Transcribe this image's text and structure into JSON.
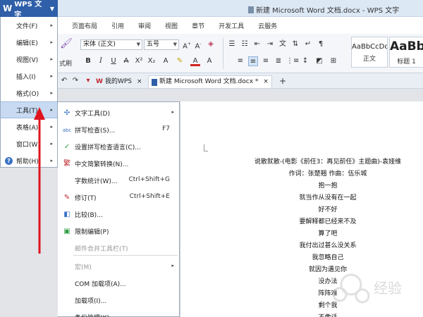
{
  "app": {
    "name": "WPS 文字",
    "window_title": "新建 Microsoft Word 文档.docx - WPS 文字"
  },
  "ribbon_tabs": [
    "页面布局",
    "引用",
    "审阅",
    "视图",
    "章节",
    "开发工具",
    "云服务"
  ],
  "ribbon": {
    "paste_label": "式刷",
    "font_name": "宋体 (正文)",
    "font_size": "五号",
    "styles": [
      {
        "preview": "AaBbCcDd",
        "label": "正文"
      },
      {
        "preview": "AaBb",
        "label": "标题 1"
      }
    ]
  },
  "doc_tabs": [
    {
      "label": "我的WPS",
      "active": false
    },
    {
      "label": "新建 Microsoft Word 文档.docx *",
      "active": true
    }
  ],
  "main_menu": {
    "items": [
      {
        "label": "文件(F)",
        "has_submenu": true
      },
      {
        "label": "编辑(E)",
        "has_submenu": true
      },
      {
        "label": "视图(V)",
        "has_submenu": true
      },
      {
        "label": "插入(I)",
        "has_submenu": true
      },
      {
        "label": "格式(O)",
        "has_submenu": true
      },
      {
        "label": "工具(T)",
        "has_submenu": true,
        "active": true
      },
      {
        "label": "表格(A)",
        "has_submenu": true
      },
      {
        "label": "窗口(W)",
        "has_submenu": true
      },
      {
        "label": "帮助(H)",
        "has_submenu": true
      }
    ]
  },
  "tools_menu": {
    "items": [
      {
        "label": "文字工具(D)",
        "shortcut": "",
        "has_submenu": true,
        "icon": "text-tools-icon",
        "disabled": false
      },
      {
        "label": "拼写检查(S)...",
        "shortcut": "F7",
        "has_submenu": false,
        "icon": "spell-check-icon",
        "disabled": false
      },
      {
        "label": "设置拼写检查语言(C)...",
        "shortcut": "",
        "has_submenu": false,
        "icon": "language-icon",
        "disabled": false
      },
      {
        "label": "中文简繁转换(N)...",
        "shortcut": "",
        "has_submenu": false,
        "icon": "chinese-convert-icon",
        "disabled": false
      },
      {
        "label": "字数统计(W)...",
        "shortcut": "Ctrl+Shift+G",
        "has_submenu": false,
        "icon": "",
        "disabled": false
      },
      {
        "label": "修订(T)",
        "shortcut": "Ctrl+Shift+E",
        "has_submenu": false,
        "icon": "track-changes-icon",
        "disabled": false
      },
      {
        "label": "比较(B)...",
        "shortcut": "",
        "has_submenu": false,
        "icon": "compare-icon",
        "disabled": false
      },
      {
        "label": "限制编辑(P)",
        "shortcut": "",
        "has_submenu": false,
        "icon": "restrict-edit-icon",
        "disabled": false
      },
      {
        "label": "邮件合并工具栏(T)",
        "shortcut": "",
        "has_submenu": false,
        "icon": "",
        "disabled": true
      },
      {
        "label": "宏(M)",
        "shortcut": "",
        "has_submenu": true,
        "icon": "",
        "disabled": true
      },
      {
        "label": "COM 加载项(A)...",
        "shortcut": "",
        "has_submenu": false,
        "icon": "",
        "disabled": false
      },
      {
        "label": "加载项(I)...",
        "shortcut": "",
        "has_submenu": false,
        "icon": "",
        "disabled": false
      },
      {
        "label": "备份管理(K)...",
        "shortcut": "",
        "has_submenu": false,
        "icon": "",
        "disabled": false
      }
    ]
  },
  "document": {
    "lines": [
      "说散就散-(电影《前任3：再见前任》主题曲)-袁娅维",
      "作词：张楚翘 作曲：伍乐城",
      "抱一抱",
      "就当作从没有在一起",
      "好不好",
      "要解释都已经来不及",
      "算了吧",
      "我付出过甚么没关系",
      "我忽略自己",
      "就因为遇见你",
      "没办法",
      "阵阵难",
      "剩个我",
      "不像话"
    ]
  },
  "watermark": "经验",
  "colors": {
    "app_button": "#2e5fa8",
    "menu_highlight": "#c7daf2",
    "annotation_arrow": "#e0141e"
  }
}
